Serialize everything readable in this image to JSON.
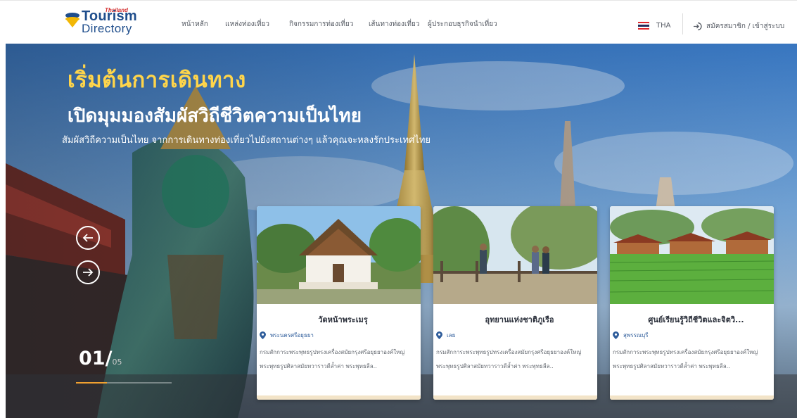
{
  "brand": {
    "tag": "Thailand",
    "name_line1": "Tourism",
    "name_line2": "Directory"
  },
  "nav": {
    "items": [
      {
        "label": "หน้าหลัก"
      },
      {
        "label": "แหล่งท่องเที่ยว"
      },
      {
        "label": "กิจกรรมการท่องเที่ยว"
      },
      {
        "label": "เส้นทางท่องเที่ยว"
      },
      {
        "label": "ผู้ประกอบธุรกิจนำเที่ยว"
      }
    ],
    "language": "THA",
    "login": "สมัครสมาชิก / เข้าสู่ระบบ"
  },
  "hero": {
    "title": "เริ่มต้นการเดินทาง",
    "subtitle": "เปิดมุมมองสัมผัสวิถีชีวิตความเป็นไทย",
    "description": "สัมผัสวิถีความเป็นไทย จากการเดินทางท่องเที่ยวไปยังสถานต่างๆ แล้วคุณจะหลงรักประเทศไทย",
    "counter_current": "01",
    "counter_separator": "/",
    "counter_total": "05",
    "progress": 0.32
  },
  "cards": [
    {
      "title": "วัดหน้าพระเมรุ",
      "location": "พระนครศรีอยุธยา",
      "description": "กรมสักการะพระพุทธรูปทรงเครื่องสมัยกรุงศรีอยุธยาองค์ใหญ่ พระพุทธรูปศิลาสมัยทวาราวดีล้ำค่า พระพุทธลีล.."
    },
    {
      "title": "อุทยานแห่งชาติภูเรือ",
      "location": "เลย",
      "description": "กรมสักการะพระพุทธรูปทรงเครื่องสมัยกรุงศรีอยุธยาองค์ใหญ่ พระพุทธรูปศิลาสมัยทวาราวดีล้ำค่า พระพุทธลีล.."
    },
    {
      "title": "ศูนย์เรียนรู้วิถีชีวิตและจิตวิ...",
      "location": "สุพรรณบุรี",
      "description": "กรมสักการะพระพุทธรูปทรงเครื่องสมัยกรุงศรีอยุธยาองค์ใหญ่ พระพุทธรูปศิลาสมัยทวาราวดีล้ำค่า พระพุทธลีล.."
    }
  ],
  "colors": {
    "brand_blue": "#1f4e8c",
    "hero_title": "#ffd54a",
    "location_pin": "#2f5d9b",
    "progress_accent": "#f0a030"
  },
  "icons": [
    "tourism-logo-icon",
    "thai-flag-icon",
    "login-icon",
    "arrow-left-icon",
    "arrow-right-icon",
    "location-pin-icon"
  ]
}
